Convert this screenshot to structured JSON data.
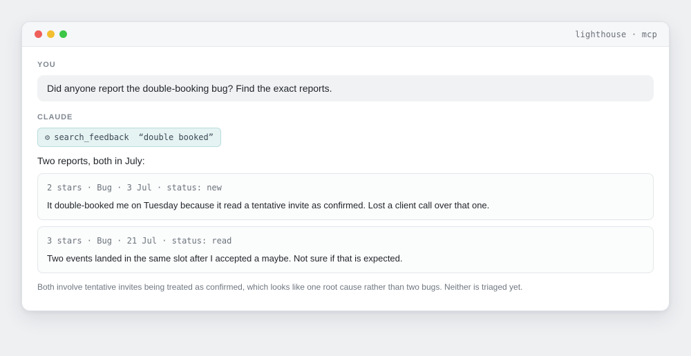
{
  "window": {
    "title": "lighthouse · mcp"
  },
  "conversation": {
    "user_label": "YOU",
    "user_message": "Did anyone report the double-booking bug? Find the exact reports.",
    "assistant_label": "CLAUDE",
    "tool_call": {
      "icon": "gear-icon",
      "name": "search_feedback",
      "query": "“double booked”"
    },
    "lead": "Two reports, both in July:",
    "reports": [
      {
        "meta": "2 stars · Bug · 3 Jul · status: new",
        "body": "It double-booked me on Tuesday because it read a tentative invite as confirmed. Lost a client call over that one."
      },
      {
        "meta": "3 stars · Bug · 21 Jul · status: read",
        "body": "Two events landed in the same slot after I accepted a maybe. Not sure if that is expected."
      }
    ],
    "summary": "Both involve tentative invites being treated as confirmed, which looks like one root cause rather than two bugs. Neither is triaged yet."
  },
  "colors": {
    "background": "#eff0f2",
    "tool_chip_bg": "#e6f3f3",
    "tool_chip_border": "#b8dcdc",
    "close": "#ee5f59",
    "minimize": "#f3bf30",
    "maximize": "#3dc748"
  }
}
